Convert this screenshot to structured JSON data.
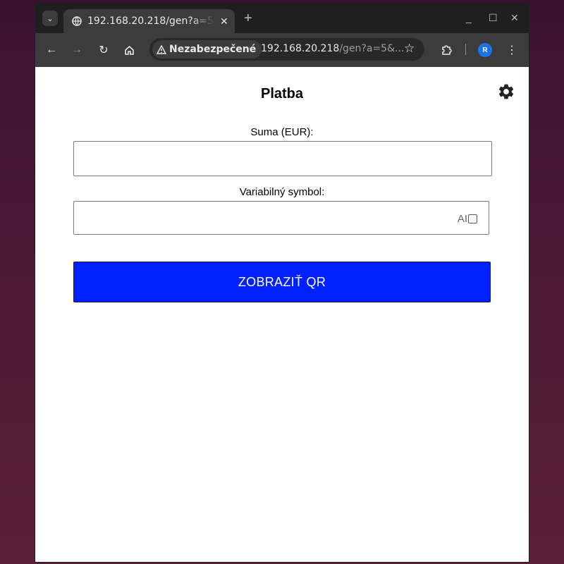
{
  "browser": {
    "tab_title": "192.168.20.218/gen?a=5",
    "security_label": "Nezabezpečené",
    "url_host": "192.168.20.218",
    "url_path": "/gen?a=5&...",
    "profile_initial": "R",
    "new_tab_label": "+",
    "minimize_label": "_",
    "maximize_label": "☐",
    "close_label": "✕"
  },
  "page": {
    "title": "Platba",
    "amount_label": "Suma (EUR):",
    "amount_value": "",
    "vs_label": "Variabilný symbol:",
    "vs_value": "",
    "ai_label": "AI",
    "ai_checked": false,
    "submit_label": "ZOBRAZIŤ QR"
  },
  "colors": {
    "button": "#0020ff",
    "chrome_dark": "#1f1f1f",
    "chrome_toolbar": "#3c3c3c",
    "profile": "#1a73e8"
  },
  "icons": [
    "tab-search-icon",
    "globe-icon",
    "close-icon",
    "back-icon",
    "forward-icon",
    "reload-icon",
    "home-icon",
    "warning-icon",
    "star-icon",
    "extensions-icon",
    "profile-avatar",
    "menu-icon",
    "gear-icon"
  ]
}
